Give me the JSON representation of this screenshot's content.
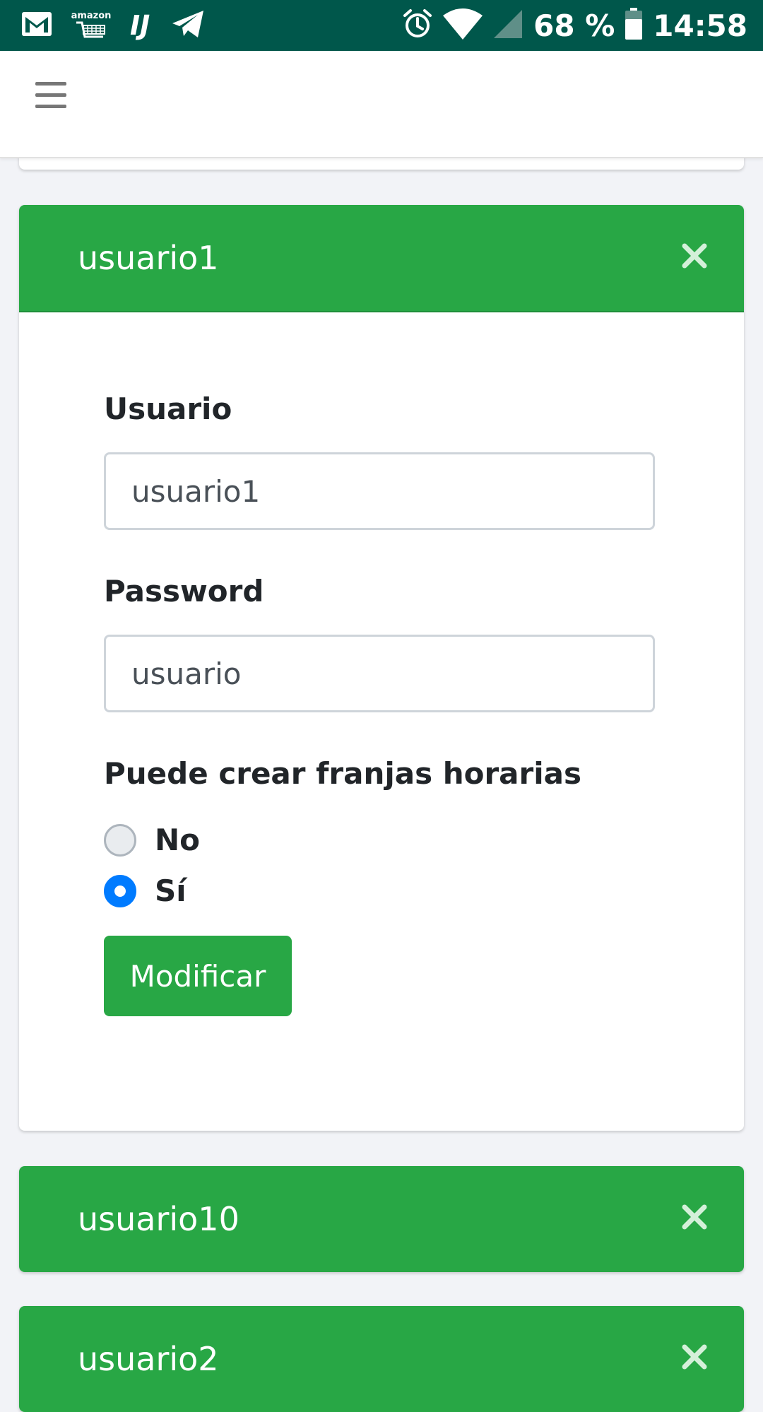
{
  "status_bar": {
    "battery": "68 %",
    "time": "14:58",
    "amazon_label": "amazon",
    "ij_label": "IJ"
  },
  "cards": [
    {
      "title": "usuario1",
      "form": {
        "user_label": "Usuario",
        "user_value": "usuario1",
        "password_label": "Password",
        "password_value": "usuario",
        "permission_label": "Puede crear franjas horarias",
        "option_no": "No",
        "option_si": "Sí",
        "selected": "Sí",
        "submit_label": "Modificar"
      }
    },
    {
      "title": "usuario10"
    },
    {
      "title": "usuario2"
    }
  ],
  "colors": {
    "status_bar": "#00574b",
    "card_header": "#28a745",
    "radio_checked": "#007bff",
    "background": "#f2f3f7"
  }
}
